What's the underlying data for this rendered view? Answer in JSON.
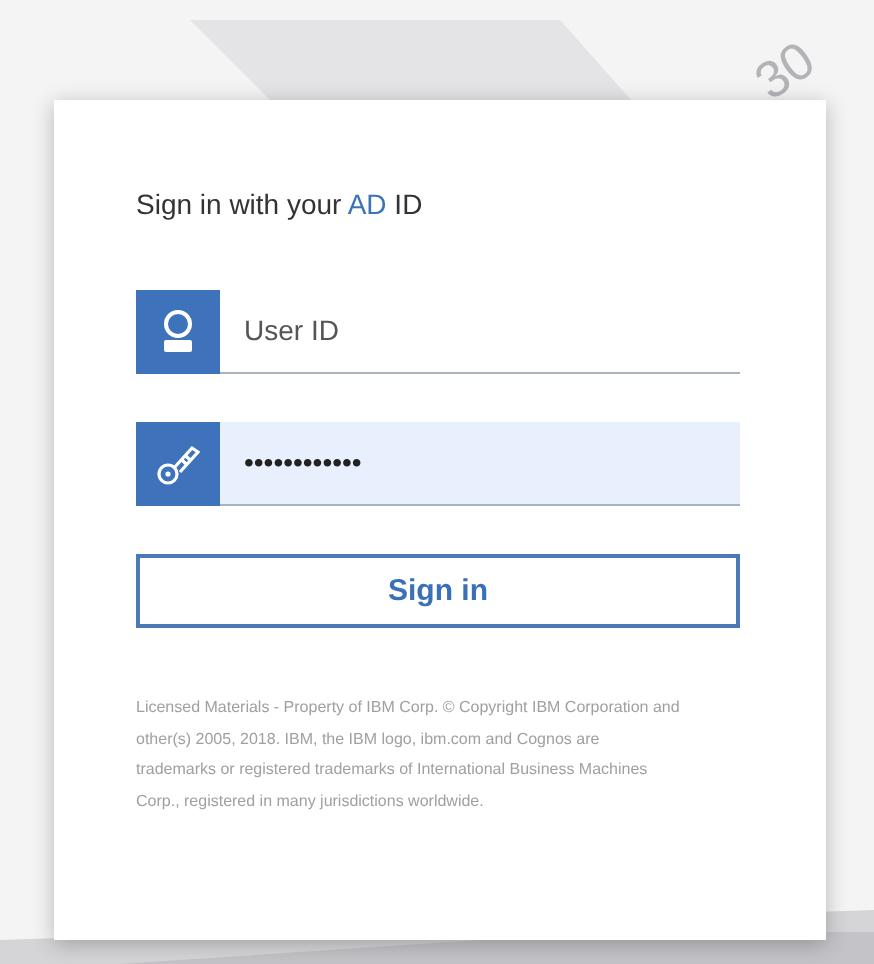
{
  "background_mark": "30",
  "heading": {
    "prefix": "Sign in with your",
    "highlight": "AD",
    "suffix": "ID"
  },
  "fields": [
    {
      "kind": "user",
      "placeholder": "User ID"
    },
    {
      "kind": "password",
      "value": "••••••••••••"
    }
  ],
  "button": "Sign in",
  "legal": "Licensed Materials - Property of IBM Corp. © Copyright IBM Corporation and other(s) 2005, 2018. IBM, the IBM logo, ibm.com and Cognos are trademarks or registered trademarks of International Business Machines Corp., registered in many jurisdictions worldwide."
}
